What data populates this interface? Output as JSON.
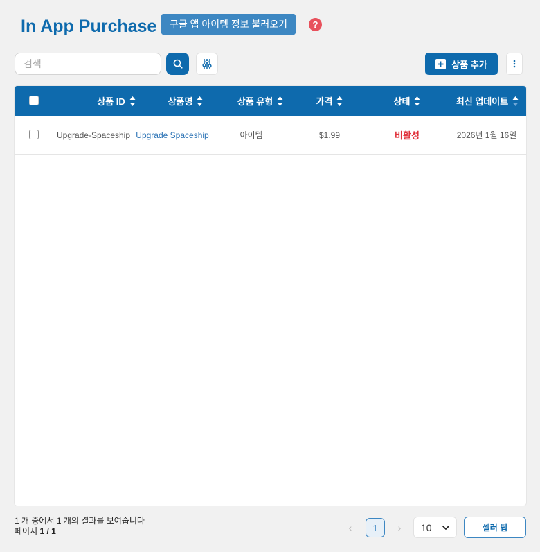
{
  "header": {
    "title": "In App Purchase",
    "import_button": "구글 앱 아이템 정보 불러오기",
    "help_icon": "?"
  },
  "toolbar": {
    "search_placeholder": "검색",
    "search_value": "",
    "add_button": "상품 추가"
  },
  "table": {
    "columns": [
      "상품 ID",
      "상품명",
      "상품 유형",
      "가격",
      "상태",
      "최신 업데이트"
    ],
    "rows": [
      {
        "product_id": "Upgrade-Spaceship",
        "name": "Upgrade Spaceship",
        "type": "아이템",
        "price": "$1.99",
        "status": "비활성",
        "updated": "2026년 1월 16일"
      }
    ]
  },
  "footer": {
    "summary": "1 개 중에서 1 개의 결과를 보여줍니다",
    "page_label": "페이지",
    "page_value": "1 / 1",
    "current_page": "1",
    "prev_arrow": "‹",
    "next_arrow": "›",
    "per_page": "10",
    "seller_tips_button": "셀러 팁"
  },
  "colors": {
    "primary": "#0e6aad",
    "secondary_button": "#3d87c2",
    "status_inactive": "#e0313b",
    "help_icon": "#e8515c",
    "link": "#2b73b5"
  },
  "icons": [
    "help-icon",
    "search-icon",
    "filter-sliders-icon",
    "plus-icon",
    "more-vertical-icon",
    "sort-icon",
    "chevron-left-icon",
    "chevron-right-icon",
    "chevron-down-icon"
  ]
}
